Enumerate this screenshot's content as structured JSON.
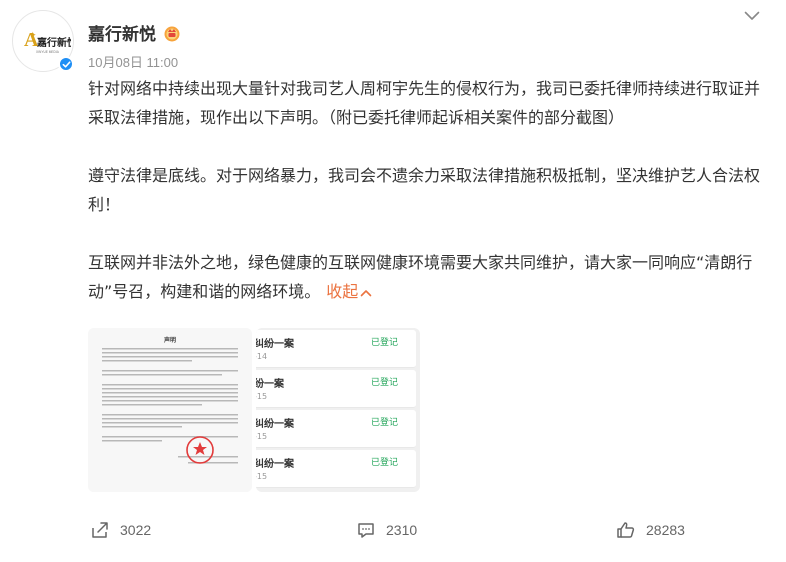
{
  "post": {
    "author": "嘉行新悦",
    "time": "10月08日 11:00",
    "paragraphs": [
      "针对网络中持续出现大量针对我司艺人周柯宇先生的侵权行为，我司已委托律师持续进行取证并采取法律措施，现作出以下声明。（附已委托律师起诉相关案件的部分截图）",
      "遵守法律是底线。对于网络暴力，我司会不遗余力采取法律措施积极抵制，坚决维护艺人合法权利！",
      "互联网并非法外之地，绿色健康的互联网健康环境需要大家共同维护，请大家一同响应“清朗行动”号召，构建和谐的网络环境。"
    ],
    "collapse_label": "收起",
    "logo_text": "嘉行新悦",
    "logo_subtext": "XINYUE MEDIA"
  },
  "images": {
    "doc_title": "声明",
    "cases": [
      {
        "title": "纠纷一案",
        "status": "已登记",
        "num": "-14"
      },
      {
        "title": "纷一案",
        "status": "已登记",
        "num": "-15"
      },
      {
        "title": "纠纷一案",
        "status": "已登记",
        "num": "-15"
      },
      {
        "title": "纠纷一案",
        "status": "已登记",
        "num": "-15"
      }
    ]
  },
  "stats": {
    "shares": "3022",
    "comments": "2310",
    "likes": "28283"
  },
  "colors": {
    "accent": "#eb7340",
    "verified": "#1f8ff5",
    "status_green": "#23a55a"
  },
  "icons": [
    "avatar-logo",
    "verified-icon",
    "badge-icon",
    "chevron-down-icon",
    "chevron-up-icon",
    "share-icon",
    "comment-icon",
    "like-icon"
  ]
}
